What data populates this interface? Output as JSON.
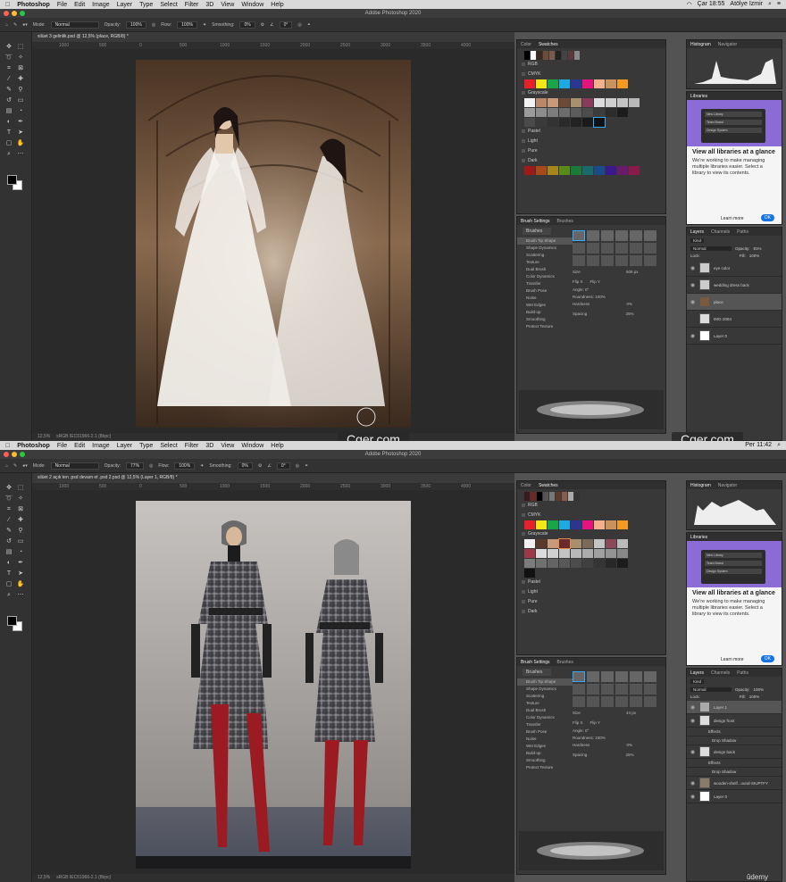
{
  "menubar": {
    "apple": "",
    "app": "Photoshop",
    "items": [
      "File",
      "Edit",
      "Image",
      "Layer",
      "Type",
      "Select",
      "Filter",
      "3D",
      "View",
      "Window",
      "Help"
    ],
    "clock_top": "Çar 18:55",
    "user": "Atölye İzmir"
  },
  "window_title": "Adobe Photoshop 2020",
  "top": {
    "doc_tab": "silüet 3 gelinlik.psd @ 12,5% (place, RGB/8) *",
    "options": {
      "mode_label": "Mode:",
      "mode": "Normal",
      "opacity_label": "Opacity:",
      "opacity": "100%",
      "flow_label": "Flow:",
      "flow": "100%",
      "smoothing_label": "Smoothing:",
      "smoothing": "0%",
      "angle": "0°"
    },
    "zoom": "12,5%",
    "profile": "sRGB IEC61966-2.1 (8bpc)",
    "color_tab": "Color",
    "swatches_tab": "Swatches",
    "swatch_groups": [
      "RGB",
      "CMYK",
      "Grayscale",
      "Pastel",
      "Light",
      "Pure",
      "Dark"
    ],
    "brush_tabs": [
      "Brush Settings",
      "Brushes"
    ],
    "brush_btn": "Brushes",
    "brush_options": [
      "Brush Tip Shape",
      "Shape Dynamics",
      "Scattering",
      "Texture",
      "Dual Brush",
      "Color Dynamics",
      "Transfer",
      "Brush Pose",
      "Noise",
      "Wet Edges",
      "Build-up",
      "Smoothing",
      "Protect Texture"
    ],
    "size_label": "Size",
    "size": "508 px",
    "flipx": "Flip X",
    "flipy": "Flip Y",
    "angle_label": "Angle:",
    "angle": "0°",
    "roundness_label": "Roundness:",
    "roundness": "100%",
    "hardness_label": "Hardness",
    "hardness": "0%",
    "spacing_label": "Spacing",
    "spacing": "25%",
    "hist_tabs": [
      "Histogram",
      "Navigator"
    ],
    "libraries_label": "Libraries",
    "lib_items": [
      "New Library",
      "Team Brand",
      "Design System"
    ],
    "lib_title": "View all libraries at a glance",
    "lib_text": "We're working to make managing multiple libraries easier. Select a library to view its contents.",
    "learn_more": "Learn more",
    "ok": "OK",
    "layers_tabs": [
      "Layers",
      "Channels",
      "Paths"
    ],
    "kind": "Kind",
    "blend": "Normal",
    "opacity_label": "Opacity:",
    "opacity": "81%",
    "lock_label": "Lock:",
    "fill_label": "Fill:",
    "fill": "100%",
    "layers": [
      "eye color",
      "wedding dress back",
      "place",
      "IMG-2084",
      "Layer 0"
    ]
  },
  "bottom": {
    "doc_tab": "silüet 2 açık ten .psd devam et .psd 2.psd @ 12,5% (Layer 1, RGB/8) *",
    "options": {
      "mode_label": "Mode:",
      "mode": "Normal",
      "opacity_label": "Opacity:",
      "opacity": "77%",
      "flow_label": "Flow:",
      "flow": "100%",
      "smoothing_label": "Smoothing:",
      "smoothing": "0%",
      "angle": "0°"
    },
    "zoom": "12,5%",
    "profile": "sRGB IEC61966-2.1 (8bpc)",
    "size": "44 px",
    "opacity": "100%",
    "fill": "100%",
    "layers": [
      "Layer 1",
      "design front",
      "Effects",
      "Drop Shadow",
      "design back",
      "Effects",
      "Drop Shadow",
      "wooden-shelf...ound-SIUPTFY",
      "Layer 0"
    ],
    "clock_partial": "Per 11:42"
  },
  "watermark": "Cger.com",
  "watermark_right": "Cger.com",
  "udemy": "ûdemy",
  "ruler_ticks": [
    "1000",
    "500",
    "0",
    "500",
    "1000",
    "1500",
    "2000",
    "2500",
    "3000",
    "3500",
    "4000",
    "4500",
    "5000",
    "5500",
    "6000",
    "6500",
    "7000"
  ],
  "colors": {
    "accent": "#1473e6",
    "purple": "#8b6bd6"
  }
}
